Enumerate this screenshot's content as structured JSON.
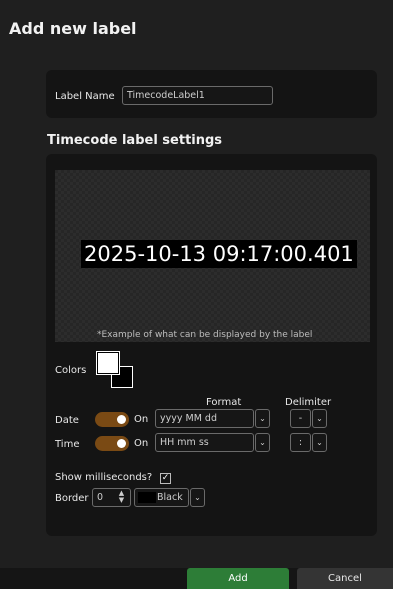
{
  "dialog": {
    "title": "Add new label"
  },
  "label_name": {
    "label": "Label Name",
    "value": "TimecodeLabel1"
  },
  "settings": {
    "title": "Timecode label settings",
    "preview_text": "2025-10-13 09:17:00.401",
    "example_note": "*Example of what can be displayed by the label",
    "colors_label": "Colors",
    "foreground_color": "#ffffff",
    "background_color": "#000000",
    "format_header": "Format",
    "delimiter_header": "Delimiter",
    "date": {
      "label": "Date",
      "toggle_text": "On",
      "enabled": true,
      "format": "yyyy MM dd",
      "delimiter": "-"
    },
    "time": {
      "label": "Time",
      "toggle_text": "On",
      "enabled": true,
      "format": "HH mm ss",
      "delimiter": ":"
    },
    "show_ms": {
      "label": "Show milliseconds?",
      "checked": true
    },
    "border": {
      "label": "Border",
      "width": "0",
      "color_name": "Black",
      "color": "#000000"
    }
  },
  "buttons": {
    "add": "Add",
    "cancel": "Cancel"
  },
  "colors": {
    "accent_toggle": "#7a4a14",
    "add_button": "#2d7d37"
  }
}
